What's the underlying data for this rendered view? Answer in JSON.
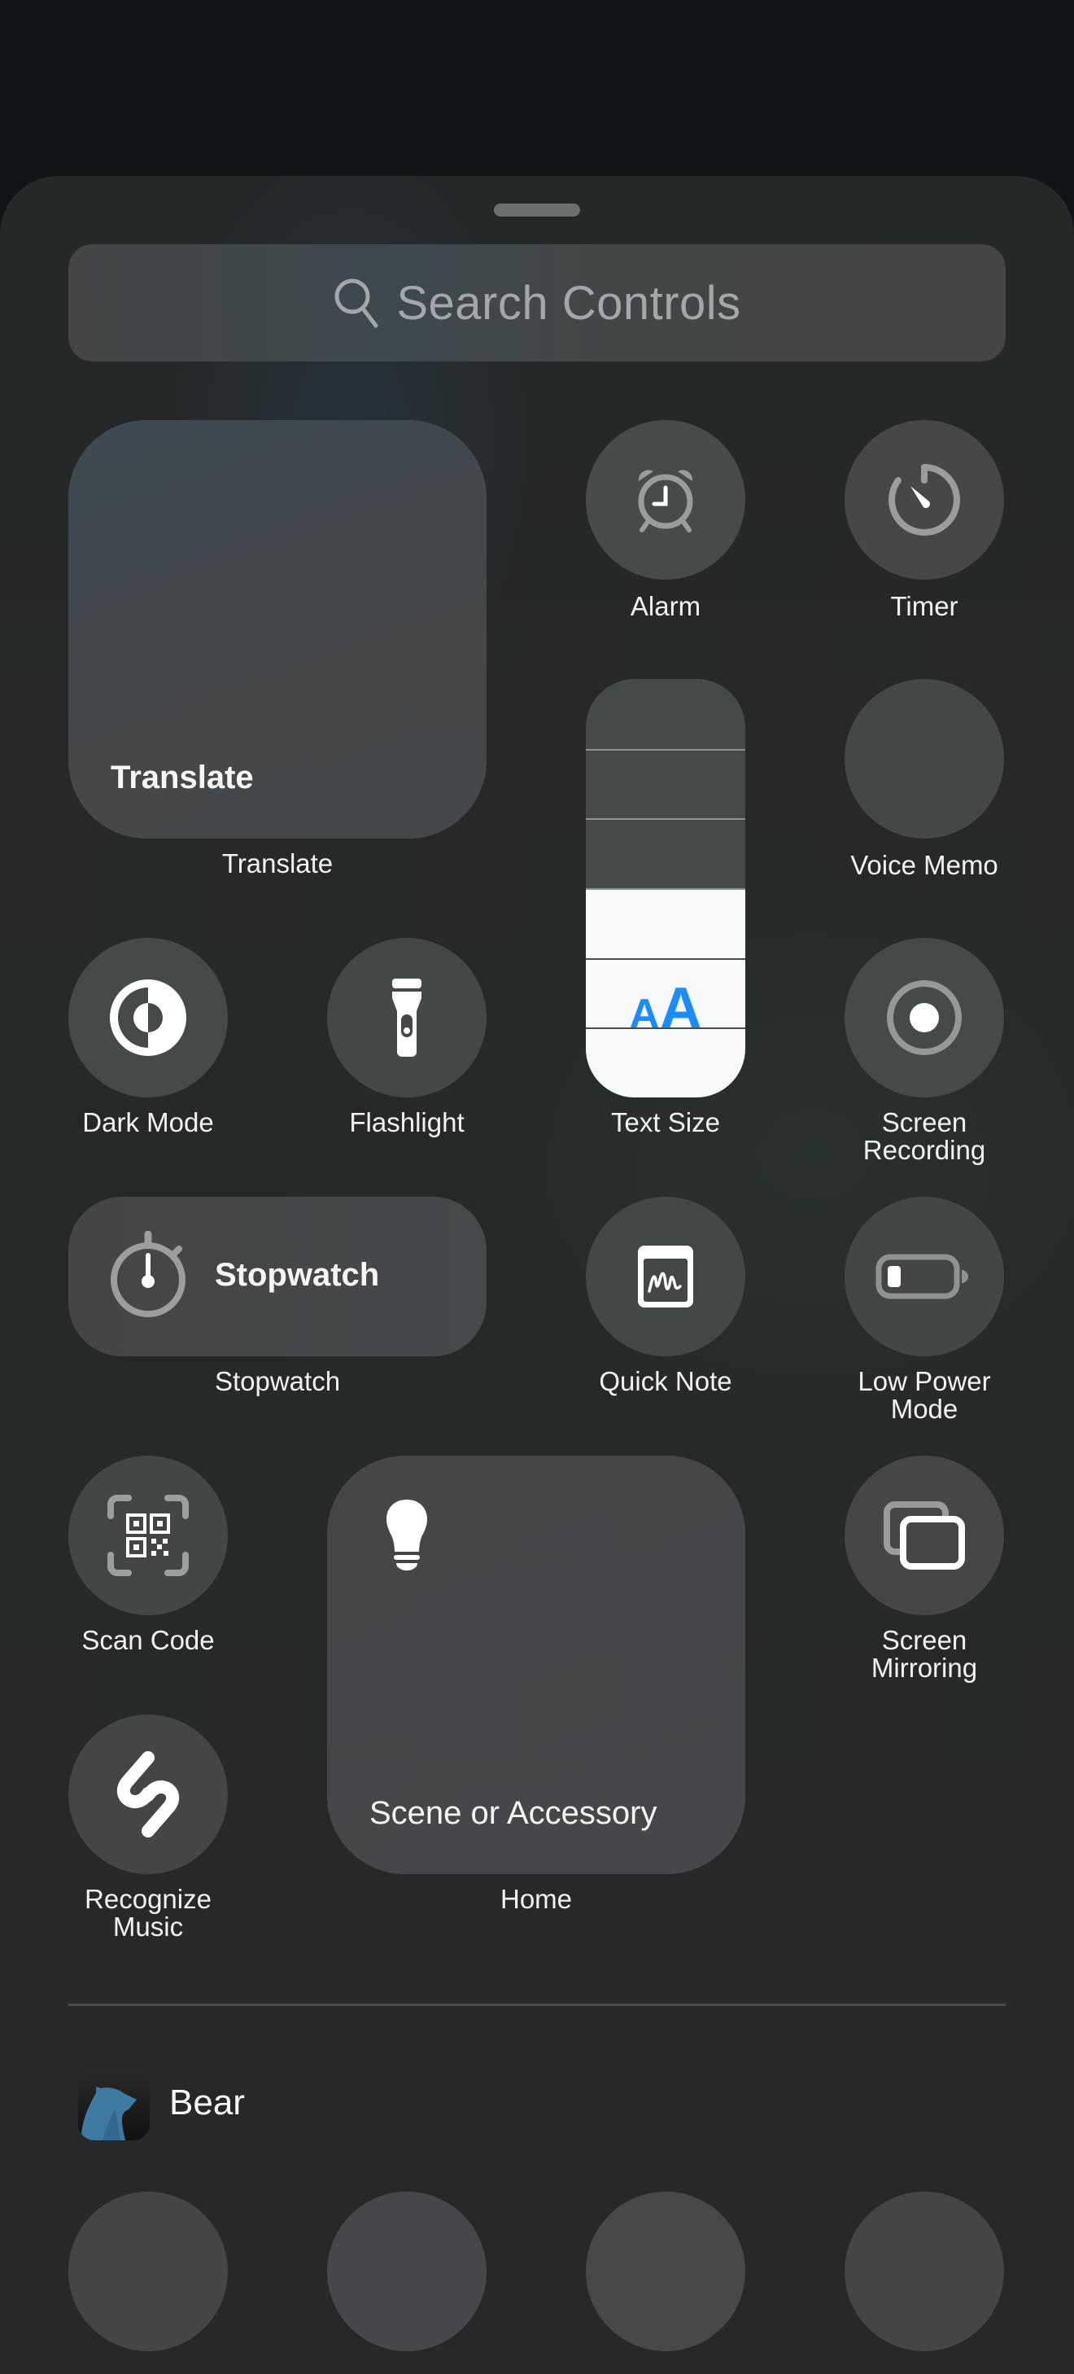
{
  "search": {
    "placeholder": "Search Controls",
    "icon": "search-icon"
  },
  "controls": {
    "translate": {
      "tile_text": "Translate",
      "label": "Translate"
    },
    "alarm": {
      "label": "Alarm",
      "icon": "alarm-clock-icon"
    },
    "timer": {
      "label": "Timer",
      "icon": "timer-icon"
    },
    "voice_memo": {
      "label": "Voice Memo"
    },
    "text_size": {
      "label": "Text Size",
      "glyph": "AA",
      "level_fraction": 0.5,
      "segments": 6,
      "accent": "#1a8cff"
    },
    "dark_mode": {
      "label": "Dark Mode",
      "icon": "dark-mode-icon"
    },
    "flashlight": {
      "label": "Flashlight",
      "icon": "flashlight-icon"
    },
    "screen_recording": {
      "label_line1": "Screen",
      "label_line2": "Recording",
      "icon": "record-icon"
    },
    "stopwatch": {
      "tile_text": "Stopwatch",
      "label": "Stopwatch",
      "icon": "stopwatch-icon"
    },
    "quick_note": {
      "label": "Quick Note",
      "icon": "quick-note-icon"
    },
    "low_power": {
      "label_line1": "Low Power",
      "label_line2": "Mode",
      "icon": "battery-low-icon"
    },
    "scan_code": {
      "label": "Scan Code",
      "icon": "qr-code-icon"
    },
    "home": {
      "tile_text": "Scene or Accessory",
      "label": "Home",
      "icon": "lightbulb-icon"
    },
    "screen_mirroring": {
      "label_line1": "Screen",
      "label_line2": "Mirroring",
      "icon": "screen-mirroring-icon"
    },
    "recognize_music": {
      "label_line1": "Recognize",
      "label_line2": "Music",
      "icon": "shazam-icon"
    }
  },
  "app_section": {
    "app_name": "Bear",
    "icon": "bear-app-icon",
    "placeholder_controls": 4
  }
}
